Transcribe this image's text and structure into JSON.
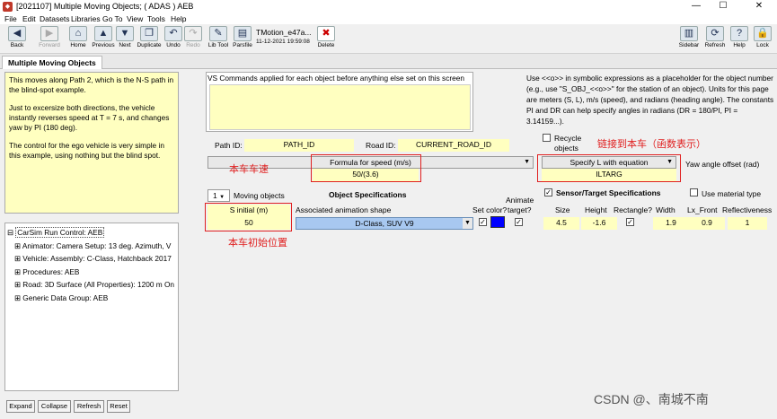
{
  "window": {
    "title": "[2021107] Multiple Moving Objects; ( ADAS ) AEB",
    "app_icon": "carsim-icon",
    "min": "—",
    "max": "☐",
    "close": "✕"
  },
  "menu": [
    "File",
    "Edit",
    "Datasets",
    "Libraries",
    "Go To",
    "View",
    "Tools",
    "Help"
  ],
  "toolbar": {
    "back": "Back",
    "forward": "Forward",
    "home": "Home",
    "previous": "Previous",
    "next": "Next",
    "duplicate": "Duplicate",
    "undo": "Undo",
    "redo": "Redo",
    "libtool": "Lib Tool",
    "parsfile": "Parsfile",
    "dataset_name": "TMotion_e47a...",
    "dataset_date": "11-12-2021 19:59:08",
    "delete": "Delete",
    "sidebar": "Sidebar",
    "refresh": "Refresh",
    "help": "Help",
    "lock": "Lock"
  },
  "tab": "Multiple Moving Objects",
  "notes": [
    "This moves along Path 2, which is the N-S path in the blind-spot example.",
    "Just to excersize both directions, the vehicle instantly reverses speed at T = 7 s, and changes yaw by PI (180 deg).",
    "The control for the ego vehicle is very simple in this example, using nothing but the blind spot."
  ],
  "tree": [
    "CarSim Run Control: AEB",
    "Animator: Camera Setup: 13 deg. Azimuth, V",
    "Vehicle: Assembly: C-Class, Hatchback 2017",
    "Procedures: AEB",
    "Road: 3D Surface (All Properties): 1200 m On",
    "Generic Data Group: AEB"
  ],
  "bottom_buttons": [
    "Expand",
    "Collapse",
    "Refresh",
    "Reset"
  ],
  "vs_commands_title": "VS Commands applied for each object before anything else set on this screen",
  "help_text": "Use <<o>> in symbolic expressions as a placeholder for the object number (e.g., use \"S_OBJ_<<o>>\" for the station of an object). Units for this page are meters (S, L), m/s (speed), and radians (heading angle). The constants PI and DR can help specify angles in radians (DR = 180/PI, PI = 3.14159...).",
  "path_id_label": "Path ID:",
  "path_id": "PATH_ID",
  "road_id_label": "Road ID:",
  "road_id": "CURRENT_ROAD_ID",
  "recycle": "Recycle objects",
  "speed_combo": "Formula for speed (m/s)",
  "speed_value": "50/(3.6)",
  "l_combo": "Specify L with equation",
  "l_value": "ILTARG",
  "yaw_label": "Yaw angle offset (rad)",
  "num_objects": "1",
  "moving_objects": "Moving objects",
  "object_spec": "Object Specifications",
  "sensor_spec": "Sensor/Target Specifications",
  "use_material": "Use material type",
  "s_initial_label": "S initial (m)",
  "s_initial": "50",
  "anim_shape_label": "Associated animation shape",
  "anim_shape": "D-Class, SUV V9",
  "set_color": "Set color?",
  "animate_target": "Animate target?",
  "col_headers": [
    "Size",
    "Height",
    "Rectangle?",
    "Width",
    "Lx_Front",
    "Reflectiveness"
  ],
  "values": {
    "size": "4.5",
    "height": "-1.6",
    "width": "1.9",
    "lx_front": "0.9",
    "reflectiveness": "1"
  },
  "annotations": {
    "speed": "本车车速",
    "link": "链接到本车（函数表示）",
    "initial": "本车初始位置"
  },
  "watermark": "CSDN @、南城不南",
  "colors": {
    "swatch": "#0000ff",
    "annotation": "#e02020",
    "field": "#ffffc0"
  }
}
